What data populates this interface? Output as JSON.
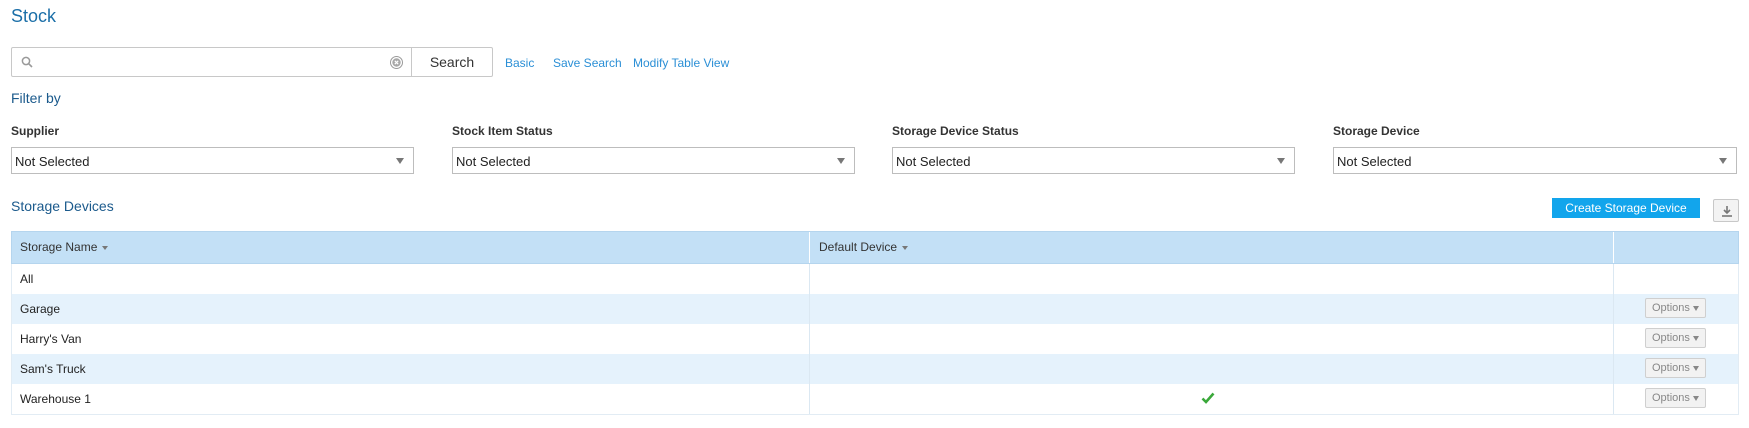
{
  "page": {
    "title": "Stock"
  },
  "search": {
    "value": "",
    "placeholder": "",
    "button_label": "Search",
    "icon": "search-icon",
    "clear_icon": "clear-icon"
  },
  "links": {
    "basic": "Basic",
    "save_search": "Save Search",
    "modify_table_view": "Modify Table View"
  },
  "filters": {
    "title": "Filter by",
    "items": [
      {
        "label": "Supplier",
        "value": "Not Selected"
      },
      {
        "label": "Stock Item Status",
        "value": "Not Selected"
      },
      {
        "label": "Storage Device Status",
        "value": "Not Selected"
      },
      {
        "label": "Storage Device",
        "value": "Not Selected"
      }
    ]
  },
  "storage": {
    "title": "Storage Devices",
    "create_button": "Create Storage Device",
    "download_icon": "download-icon",
    "columns": [
      "Storage Name",
      "Default Device"
    ],
    "options_label": "Options",
    "rows": [
      {
        "name": "All",
        "default": false,
        "has_options": false
      },
      {
        "name": "Garage",
        "default": false,
        "has_options": true
      },
      {
        "name": "Harry's Van",
        "default": false,
        "has_options": true
      },
      {
        "name": "Sam's Truck",
        "default": false,
        "has_options": true
      },
      {
        "name": "Warehouse 1",
        "default": true,
        "has_options": true
      }
    ]
  },
  "colors": {
    "accent": "#12a5ec",
    "title": "#1b6fa8",
    "link": "#2b8fd6",
    "header_bg": "#c3e0f6",
    "alt_row": "#e5f2fc",
    "check": "#3aa83a"
  }
}
